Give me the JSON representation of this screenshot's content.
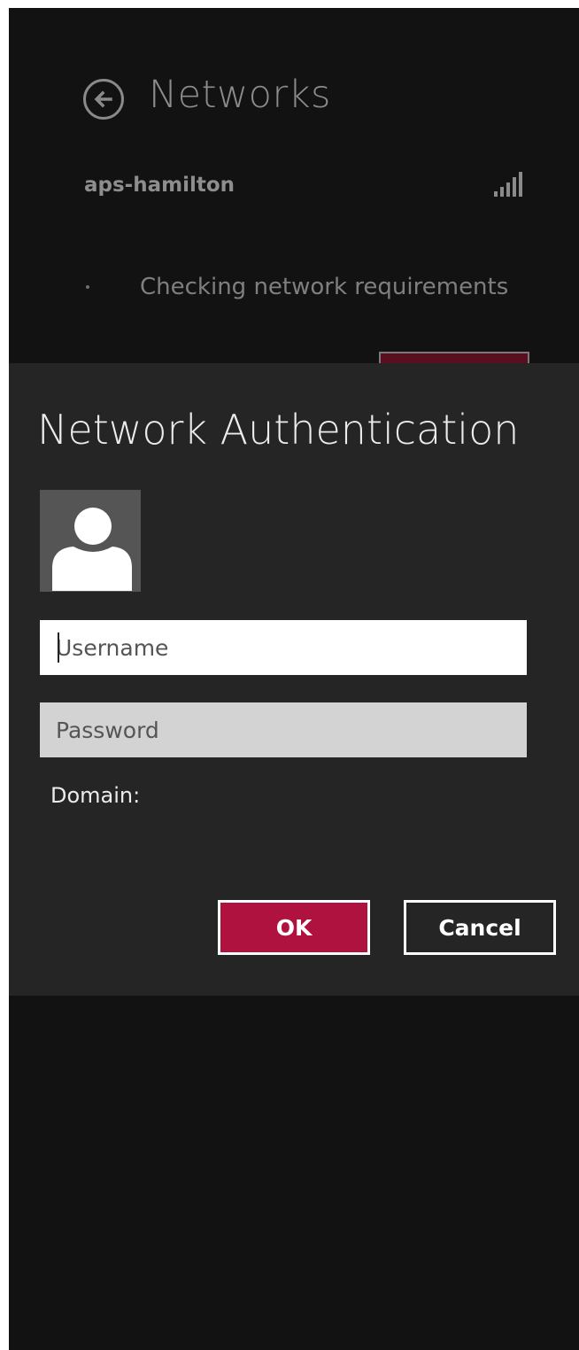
{
  "networks": {
    "title": "Networks",
    "back_icon": "back-arrow-icon",
    "network_name": "aps-hamilton",
    "signal_icon": "wifi-signal-icon",
    "status": "Checking network requirements"
  },
  "dialog": {
    "title": "Network Authentication",
    "avatar_icon": "user-avatar-icon",
    "username_placeholder": "Username",
    "password_placeholder": "Password",
    "domain_label": "Domain:",
    "ok_label": "OK",
    "cancel_label": "Cancel"
  },
  "colors": {
    "accent": "#b0123f",
    "background": "#121212",
    "dialog_background": "#252525"
  }
}
